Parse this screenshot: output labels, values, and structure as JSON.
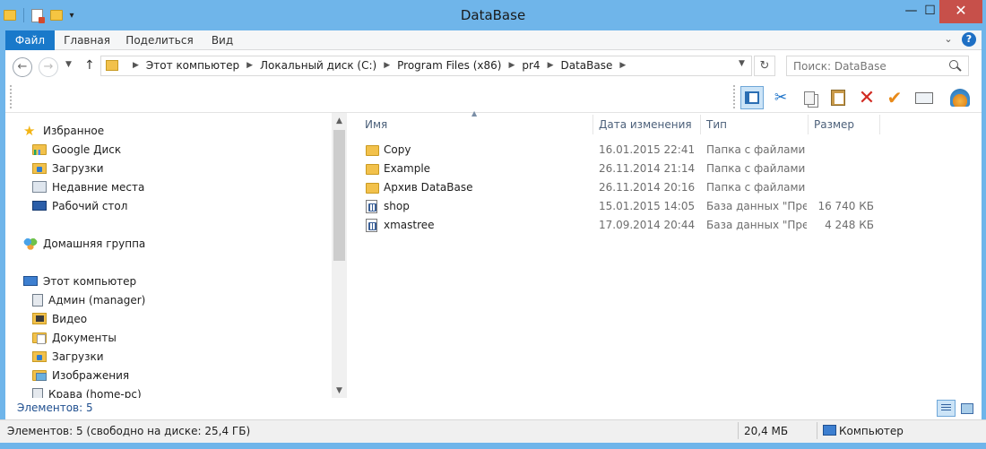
{
  "window": {
    "title": "DataBase",
    "buttons": {
      "minimize": "—",
      "maximize": "☐",
      "close": "✕"
    }
  },
  "ribbon": {
    "tabs": [
      "Файл",
      "Главная",
      "Поделиться",
      "Вид"
    ],
    "help": "?"
  },
  "address_bar": {
    "crumbs": [
      "Этот компьютер",
      "Локальный диск (C:)",
      "Program Files (x86)",
      "pr4",
      "DataBase"
    ]
  },
  "search": {
    "placeholder": "Поиск: DataBase"
  },
  "toolbar": {
    "icons": [
      "preview-pane-icon",
      "cut-icon",
      "copy-icon",
      "paste-icon",
      "delete-icon",
      "rename-icon",
      "properties-icon",
      "shell-icon"
    ]
  },
  "nav_pane": {
    "favorites_label": "Избранное",
    "favorites": [
      "Google Диск",
      "Загрузки",
      "Недавние места",
      "Рабочий стол"
    ],
    "homegroup_label": "Домашняя группа",
    "computer_label": "Этот компьютер",
    "computer_items": [
      "Админ (manager)",
      "Видео",
      "Документы",
      "Загрузки",
      "Изображения",
      "Крава (home-pc)"
    ]
  },
  "file_list": {
    "columns": {
      "name": "Имя",
      "date": "Дата изменения",
      "type": "Тип",
      "size": "Размер"
    },
    "rows": [
      {
        "name": "Copy",
        "date": "16.01.2015 22:41",
        "type": "Папка с файлами",
        "size": "",
        "kind": "folder"
      },
      {
        "name": "Example",
        "date": "26.11.2014 21:14",
        "type": "Папка с файлами",
        "size": "",
        "kind": "folder"
      },
      {
        "name": "Архив DataBase",
        "date": "26.11.2014 20:16",
        "type": "Папка с файлами",
        "size": "",
        "kind": "folder"
      },
      {
        "name": "shop",
        "date": "15.01.2015 14:05",
        "type": "База данных \"Пре...",
        "size": "16 740 КБ",
        "kind": "database"
      },
      {
        "name": "xmastree",
        "date": "17.09.2014 20:44",
        "type": "База данных \"Пре...",
        "size": "4 248 КБ",
        "kind": "database"
      }
    ]
  },
  "status": {
    "items_count": "Элементов: 5",
    "bottom_left": "Элементов: 5 (свободно на диске: 25,4 ГБ)",
    "bottom_size": "20,4 МБ",
    "bottom_location": "Компьютер"
  },
  "colors": {
    "frame": "#6fb5ea",
    "file_tab": "#1979ca",
    "close_button": "#c7504a",
    "status_text": "#1f4f8f"
  }
}
